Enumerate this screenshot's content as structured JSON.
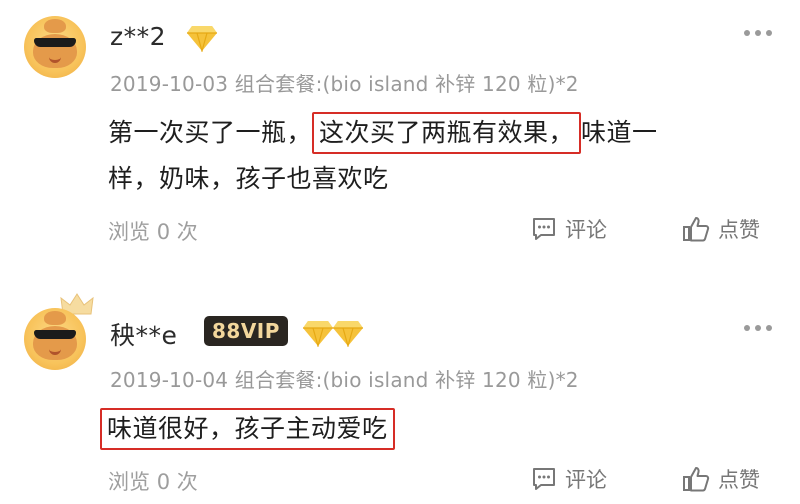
{
  "colors": {
    "highlight_border": "#d62d26",
    "gem": "#f5c23a",
    "vip_badge_bg": "#2a2621",
    "vip_badge_text": "#f3d79c",
    "meta_text": "#999999"
  },
  "reviews": [
    {
      "username": "z**2",
      "badges": [
        "diamond-gem-icon"
      ],
      "date": "2019-10-03",
      "spec": "组合套餐:(bio island 补锌 120 粒)*2",
      "content_before": "第一次买了一瓶，",
      "content_highlight": "这次买了两瓶有效果，",
      "content_after_line1": "味道一",
      "content_line2": "样，奶味，孩子也喜欢吃",
      "views_label": "浏览",
      "views_count": "0",
      "views_unit": "次",
      "comment_label": "评论",
      "like_label": "点赞"
    },
    {
      "username": "秧**e",
      "vip_label": "88VIP",
      "badges": [
        "crown-icon",
        "diamond-gem-icon",
        "diamond-gem-icon"
      ],
      "date": "2019-10-04",
      "spec": "组合套餐:(bio island 补锌 120 粒)*2",
      "content_highlight": "味道很好，孩子主动爱吃",
      "views_label": "浏览",
      "views_count": "0",
      "views_unit": "次",
      "comment_label": "评论",
      "like_label": "点赞"
    }
  ]
}
